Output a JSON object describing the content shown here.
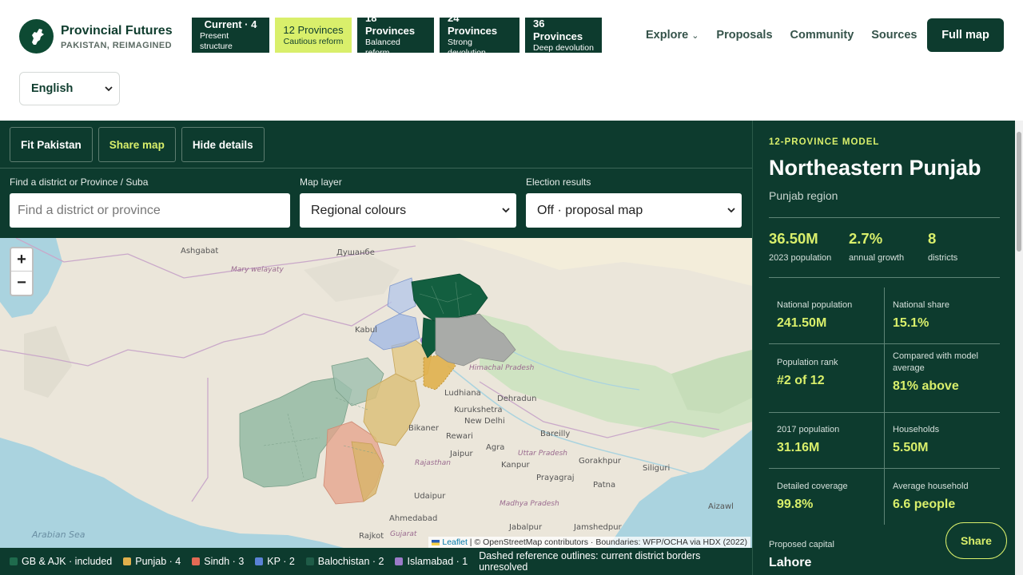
{
  "brand": {
    "title": "Provincial Futures",
    "subtitle": "PAKISTAN, REIMAGINED"
  },
  "models": [
    {
      "title": "Current · 4",
      "subtitle": "Present structure",
      "active": false
    },
    {
      "title": "12 Provinces",
      "subtitle": "Cautious reform",
      "active": true
    },
    {
      "title": "18 Provinces",
      "subtitle": "Balanced reform",
      "active": false
    },
    {
      "title": "24 Provinces",
      "subtitle": "Strong devolution",
      "active": false
    },
    {
      "title": "36 Provinces",
      "subtitle": "Deep devolution",
      "active": false
    }
  ],
  "nav": {
    "explore": "Explore",
    "proposals": "Proposals",
    "community": "Community",
    "sources": "Sources",
    "full_map": "Full map"
  },
  "language": {
    "selected": "English"
  },
  "tools": {
    "fit": "Fit Pakistan",
    "share": "Share map",
    "hide": "Hide details"
  },
  "filters": {
    "search_label": "Find a district or Province / Suba",
    "search_placeholder": "Find a district or province",
    "layer_label": "Map layer",
    "layer_value": "Regional colours",
    "election_label": "Election results",
    "election_value": "Off · proposal map"
  },
  "map": {
    "zoom_in": "+",
    "zoom_out": "−",
    "attribution_leaflet": "Leaflet",
    "attribution_rest": " | © OpenStreetMap contributors · Boundaries: WFP/OCHA via HDX (2022)",
    "labels": [
      "Ashgabat",
      "Душанбе",
      "Kabul",
      "Ludhiana",
      "Dehradun",
      "New Delhi",
      "Jaipur",
      "Agra",
      "Kanpur",
      "Rewari",
      "Kurukshetra",
      "Bikaner",
      "Udaipur",
      "Ahmedabad",
      "Rajkot",
      "Bareilly",
      "Gorakhpur",
      "Patna",
      "Prayagraj",
      "Jabalpur",
      "Jamshedpur",
      "Siliguri",
      "Aizawl",
      "Himachal Pradesh",
      "Uttar Pradesh",
      "Madhya Pradesh",
      "Rajasthan",
      "Gujarat",
      "Mary welayaty",
      "Arabian Sea"
    ],
    "colors": {
      "gb_ajk": "#0f5a3c",
      "punjab": "#d9b45a",
      "sindh": "#e07a6a",
      "kp": "#6b8fd6",
      "balochistan": "#8fb8a0",
      "islamabad": "#9c7fc8",
      "disputed": "#a9aba8"
    }
  },
  "legend": [
    {
      "label": "GB & AJK · included",
      "color": "#1f6b4d"
    },
    {
      "label": "Punjab · 4",
      "color": "#e0b04c"
    },
    {
      "label": "Sindh · 3",
      "color": "#e36a55"
    },
    {
      "label": "KP · 2",
      "color": "#5a82d6"
    },
    {
      "label": "Balochistan · 2",
      "color": "#1f5c48"
    },
    {
      "label": "Islamabad · 1",
      "color": "#9b7bc9"
    }
  ],
  "legend_note": "Dashed reference outlines: current district borders unresolved",
  "panel": {
    "kicker": "12-PROVINCE MODEL",
    "title": "Northeastern Punjab",
    "subtitle": "Punjab region",
    "stats": [
      {
        "value": "36.50M",
        "label": "2023 population"
      },
      {
        "value": "2.7%",
        "label": "annual growth"
      },
      {
        "value": "8",
        "label": "districts"
      }
    ],
    "cells": [
      {
        "label": "National population",
        "value": "241.50M"
      },
      {
        "label": "National share",
        "value": "15.1%"
      },
      {
        "label": "Population rank",
        "value": "#2 of 12"
      },
      {
        "label": "Compared with model average",
        "value": "81% above"
      },
      {
        "label": "2017 population",
        "value": "31.16M"
      },
      {
        "label": "Households",
        "value": "5.50M"
      },
      {
        "label": "Detailed coverage",
        "value": "99.8%"
      },
      {
        "label": "Average household",
        "value": "6.6 people"
      }
    ],
    "capital_label": "Proposed capital",
    "capital_value": "Lahore",
    "share": "Share"
  }
}
